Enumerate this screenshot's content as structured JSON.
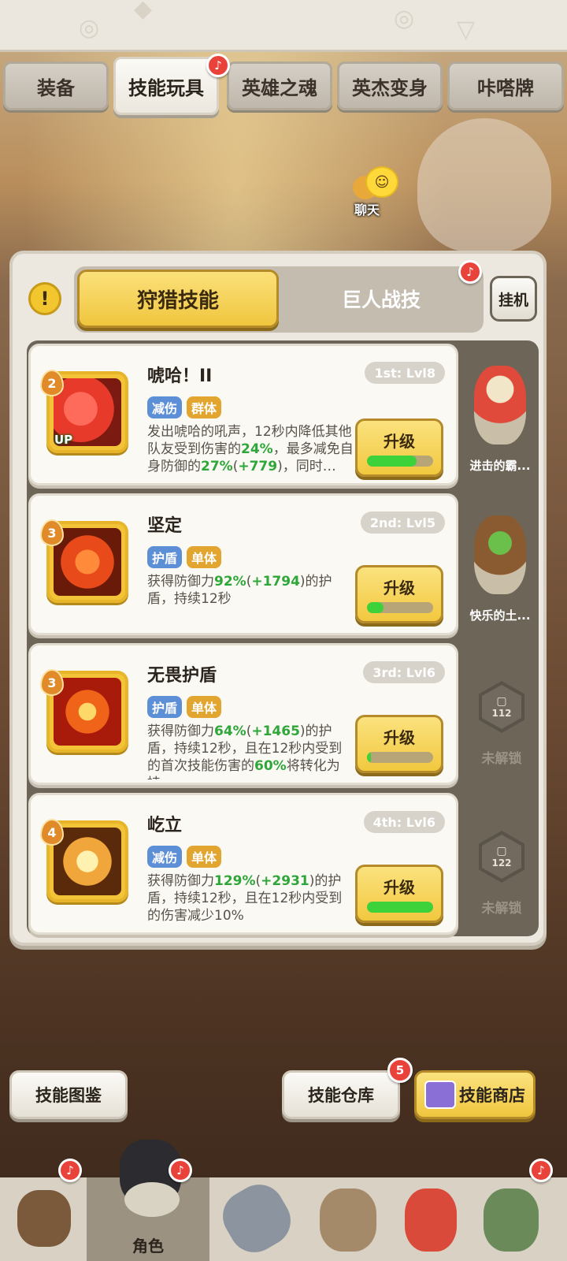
{
  "top_tabs": [
    {
      "label": "装备",
      "active": false
    },
    {
      "label": "技能玩具",
      "active": true
    },
    {
      "label": "英雄之魂",
      "active": false
    },
    {
      "label": "英杰变身",
      "active": false
    },
    {
      "label": "咔嗒牌",
      "active": false
    }
  ],
  "chat": {
    "label": "聊天",
    "icon": "chat-bubble-icon"
  },
  "segment": {
    "active_label": "狩猎技能",
    "inactive_label": "巨人战技",
    "idle_label": "挂机",
    "warning_icon": "exclamation-icon"
  },
  "skills": [
    {
      "rank": "2",
      "name": "唬哈！II",
      "slot": "1st: Lvl8",
      "tags": [
        "减伤",
        "群体"
      ],
      "desc_parts": [
        "发出唬哈的吼声，12秒内降低其他队友受到伤害的",
        "24%",
        "，最多减免自身防御的",
        "27%",
        "(",
        "+779",
        ")，同时…"
      ],
      "button": "升级",
      "progress": 0.75,
      "has_up": true,
      "up_label": "UP",
      "side": {
        "type": "pet",
        "name": "进击的霸..."
      }
    },
    {
      "rank": "3",
      "name": "坚定",
      "slot": "2nd: Lvl5",
      "tags": [
        "护盾",
        "单体"
      ],
      "desc_parts": [
        "获得防御力",
        "92%",
        "(",
        "+1794",
        ")的护盾，持续12秒"
      ],
      "button": "升级",
      "progress": 0.25,
      "has_up": false,
      "side": {
        "type": "pet",
        "name": "快乐的土..."
      }
    },
    {
      "rank": "3",
      "name": "无畏护盾",
      "slot": "3rd: Lvl6",
      "tags": [
        "护盾",
        "单体"
      ],
      "desc_parts": [
        "获得防御力",
        "64%",
        "(",
        "+1465",
        ")的护盾，持续12秒，且在12秒内受到的首次技能伤害的",
        "60%",
        "将转化为持…"
      ],
      "button": "升级",
      "progress": 0.06,
      "has_up": false,
      "side": {
        "type": "locked",
        "level": "112",
        "name": "未解锁"
      }
    },
    {
      "rank": "4",
      "name": "屹立",
      "slot": "4th: Lvl6",
      "tags": [
        "减伤",
        "单体"
      ],
      "desc_parts": [
        "获得防御力",
        "129%",
        "(",
        "+2931",
        ")的护盾，持续12秒，且在12秒内受到的伤害减少10%"
      ],
      "button": "升级",
      "progress": 1.0,
      "has_up": false,
      "side": {
        "type": "locked",
        "level": "122",
        "name": "未解锁"
      }
    }
  ],
  "bottom_buttons": {
    "codex": "技能图鉴",
    "warehouse": "技能仓库",
    "warehouse_badge": "5",
    "shop": "技能商店"
  },
  "nav": {
    "active_label": "角色"
  },
  "colors": {
    "accent_yellow": "#f2c83f",
    "progress_green": "#3ed23a",
    "highlight_green": "#2fa63a",
    "tag_blue": "#5d8fd6",
    "tag_gold": "#e2a530",
    "badge_red": "#e8423a"
  }
}
